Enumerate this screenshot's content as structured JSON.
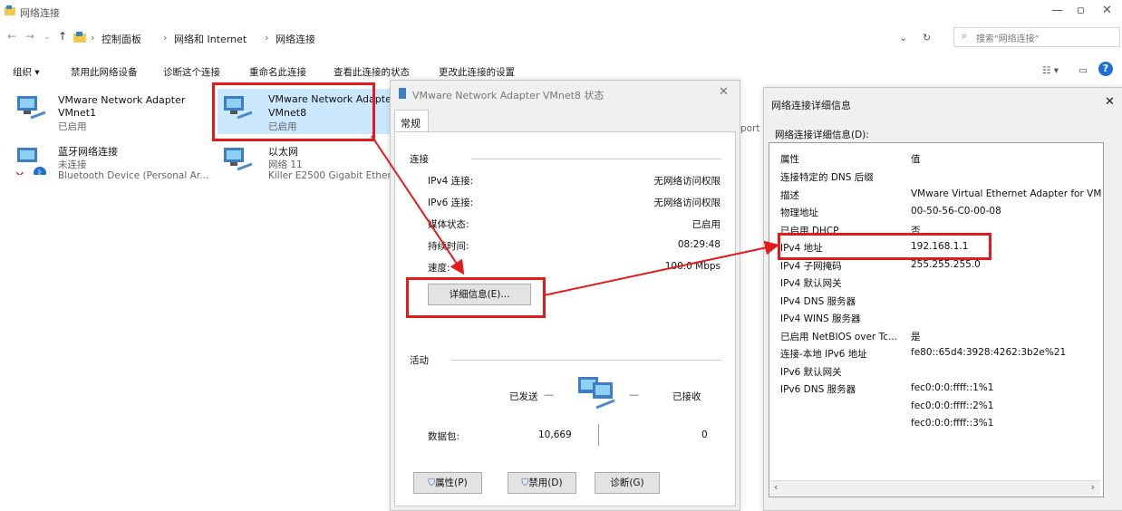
{
  "window": {
    "title": "网络连接"
  },
  "address": {
    "crumbs": [
      "控制面板",
      "网络和 Internet",
      "网络连接"
    ],
    "search_placeholder": "搜索\"网络连接\""
  },
  "toolbar": {
    "organize": "组织 ▾",
    "items": [
      "禁用此网络设备",
      "诊断这个连接",
      "重命名此连接",
      "查看此连接的状态",
      "更改此连接的设置"
    ]
  },
  "adapters": [
    {
      "name": "VMware Network Adapter",
      "line2": "VMnet1",
      "status": "已启用"
    },
    {
      "name": "蓝牙网络连接",
      "line2": "未连接",
      "status": "Bluetooth Device (Personal Ar..."
    },
    {
      "name": "VMware Network Adapte",
      "line2": "VMnet8",
      "status": "已启用"
    },
    {
      "name": "以太网",
      "line2": "网络 11",
      "status": "Killer E2500 Gigabit Ether"
    }
  ],
  "partial_text": "port (",
  "status_dialog": {
    "title": "VMware Network Adapter VMnet8 状态",
    "tab": "常规",
    "section_connection": "连接",
    "rows": [
      {
        "label": "IPv4 连接:",
        "value": "无网络访问权限"
      },
      {
        "label": "IPv6 连接:",
        "value": "无网络访问权限"
      },
      {
        "label": "媒体状态:",
        "value": "已启用"
      },
      {
        "label": "持续时间:",
        "value": "08:29:48"
      },
      {
        "label": "速度:",
        "value": "100.0 Mbps"
      }
    ],
    "details_button": "详细信息(E)...",
    "section_activity": "活动",
    "sent_label": "已发送",
    "received_label": "已接收",
    "packets_label": "数据包:",
    "packets_sent": "10,669",
    "packets_received": "0",
    "buttons": {
      "properties": "属性(P)",
      "disable": "禁用(D)",
      "diagnose": "诊断(G)"
    }
  },
  "details_dialog": {
    "title": "网络连接详细信息",
    "label": "网络连接详细信息(D):",
    "col_property": "属性",
    "col_value": "值",
    "rows": [
      {
        "p": "连接特定的 DNS 后缀",
        "v": ""
      },
      {
        "p": "描述",
        "v": "VMware Virtual Ethernet Adapter for VM"
      },
      {
        "p": "物理地址",
        "v": "00-50-56-C0-00-08"
      },
      {
        "p": "已启用 DHCP",
        "v": "否"
      },
      {
        "p": "IPv4 地址",
        "v": "192.168.1.1"
      },
      {
        "p": "IPv4 子网掩码",
        "v": "255.255.255.0"
      },
      {
        "p": "IPv4 默认网关",
        "v": ""
      },
      {
        "p": "IPv4 DNS 服务器",
        "v": ""
      },
      {
        "p": "IPv4 WINS 服务器",
        "v": ""
      },
      {
        "p": "已启用 NetBIOS over Tc...",
        "v": "是"
      },
      {
        "p": "连接-本地 IPv6 地址",
        "v": "fe80::65d4:3928:4262:3b2e%21"
      },
      {
        "p": "IPv6 默认网关",
        "v": ""
      },
      {
        "p": "IPv6 DNS 服务器",
        "v": "fec0:0:0:ffff::1%1"
      },
      {
        "p": "",
        "v": "fec0:0:0:ffff::2%1"
      },
      {
        "p": "",
        "v": "fec0:0:0:ffff::3%1"
      }
    ]
  },
  "colors": {
    "highlight": "#e21b1b",
    "dialog_bg": "#f0f0f0",
    "selected": "#cce8ff"
  }
}
